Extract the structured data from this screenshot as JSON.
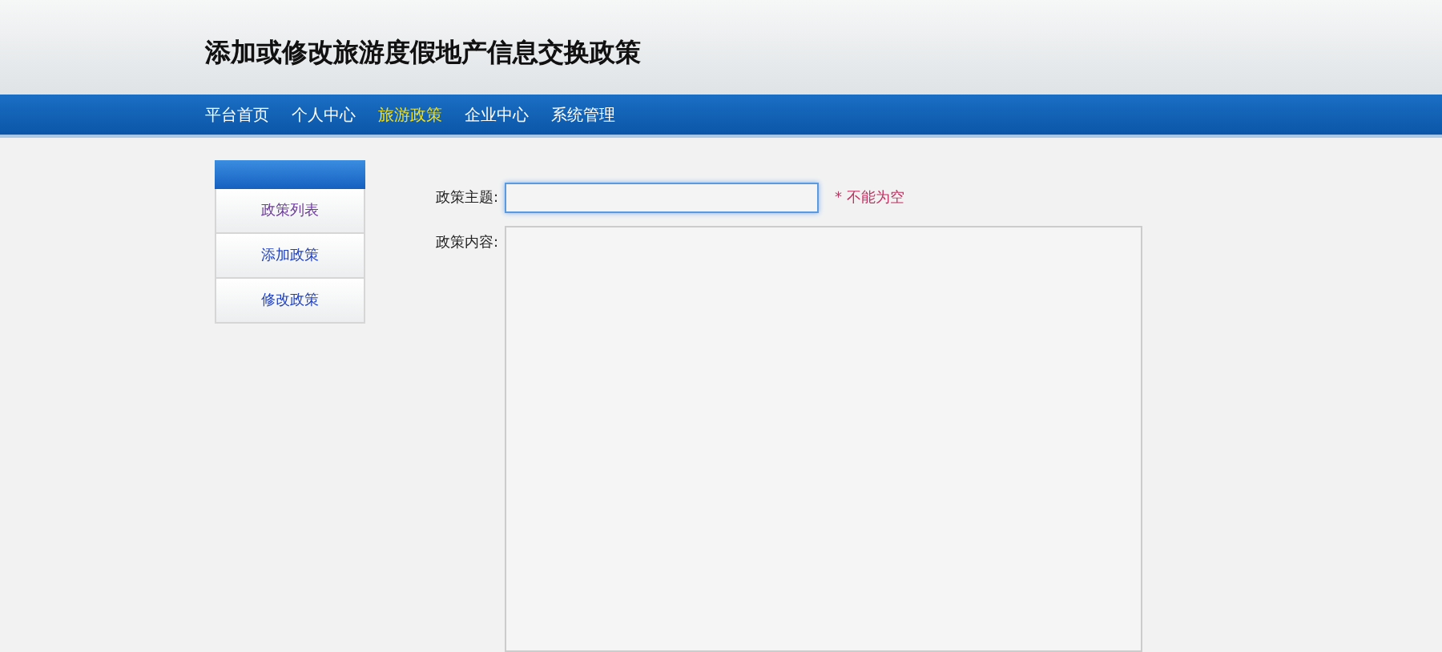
{
  "header": {
    "title": "添加或修改旅游度假地产信息交换政策"
  },
  "nav": [
    {
      "label": "平台首页",
      "selected": false
    },
    {
      "label": "个人中心",
      "selected": false
    },
    {
      "label": "旅游政策",
      "selected": true
    },
    {
      "label": "企业中心",
      "selected": false
    },
    {
      "label": "系统管理",
      "selected": false
    }
  ],
  "sidebar": {
    "items": [
      {
        "label": "政策列表",
        "visited": true
      },
      {
        "label": "添加政策",
        "visited": false
      },
      {
        "label": "修改政策",
        "visited": false
      }
    ]
  },
  "form": {
    "subject": {
      "label": "政策主题:",
      "required_mark": "*",
      "hint": "不能为空"
    },
    "content": {
      "label": "政策内容:"
    }
  }
}
